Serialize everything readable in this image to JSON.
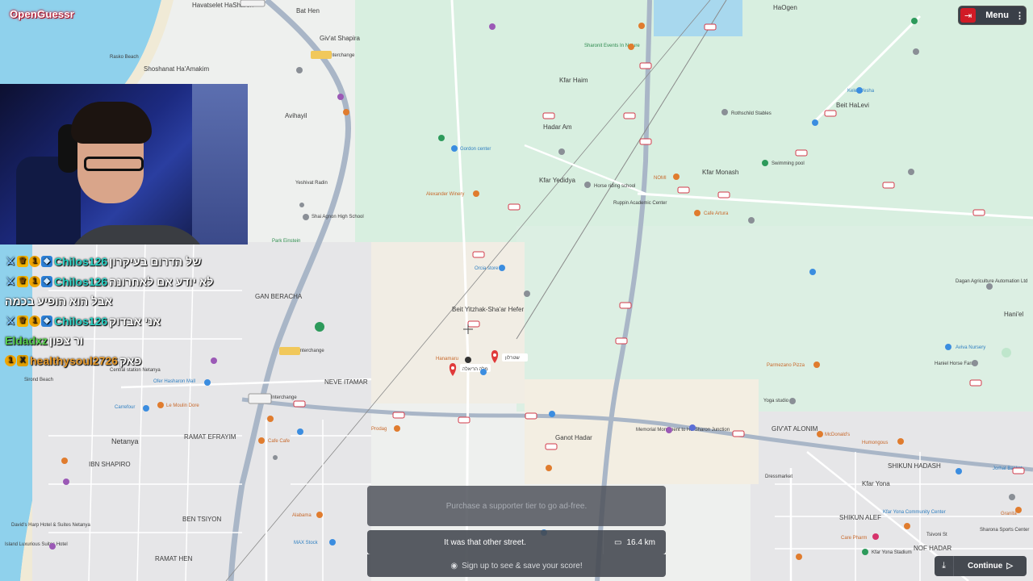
{
  "app": {
    "name": "OpenGuessr"
  },
  "colors": {
    "brand": "#d11b26",
    "panel": "#464a52",
    "user_cyan": "#2bd1c4",
    "user_green": "#58d14d",
    "user_orange": "#e89b2c"
  },
  "map": {
    "towns": [
      "Havatselet HaSharon",
      "Bat Hen",
      "Giv'at Shapira",
      "Shoshanat Ha'Amakim",
      "Avihayil",
      "Kfar Haim",
      "Hadar Am",
      "Kfar Yedidya",
      "Kfar Monash",
      "Beit HaLevi",
      "HaOgen",
      "Beit Yitzhak-Sha'ar Hefer",
      "GAN BERACHA",
      "NEVE ITAMAR",
      "Netanya",
      "RAMAT EFRAYIM",
      "IBN SHAPIRO",
      "BEN TSIYON",
      "RAMAT HEN",
      "Ganot Hadar",
      "GIV'AT ALONIM",
      "Kfar Yona",
      "SHIKUN HADASH",
      "SHIKUN ALEF",
      "NOF HADAR",
      "Hani'el"
    ],
    "pois": [
      "Rasko Beach",
      "Sharonit Events In Nature",
      "Kelev Yesha",
      "Rothschild Stables",
      "Gordon center",
      "Horse riding school",
      "Alexander Winery",
      "NOMI",
      "Ruppin Academic Center",
      "Cafe Artura",
      "Swimming pool",
      "Shai Agnon High School",
      "Yeshivat Radin",
      "Park Einstein",
      "Orcia store",
      "Dagan Agriculture Automation Ltd",
      "Aviva Nursery",
      "Haniel Horse Farm",
      "Parmezano Pizza",
      "Yoga studio",
      "Hanamaru",
      "שטרלון",
      "Ofer Hasharon Mall",
      "Central station Netanya",
      "Carrefour",
      "Le Moulin Dore",
      "Cafe Cafe",
      "Prodag",
      "Memorial Monument to Ha-Sharon Junction",
      "McDonald's",
      "Humongous",
      "Alabama",
      "MAX Stock",
      "Sirond Beach",
      "David's Harp Hotel & Suites Netanya",
      "Island Luxurious Suites Hotel",
      "Kfar Yona Community Center",
      "Kfar Yona Stadium",
      "Care Pharm",
      "Sharona Sports Center",
      "Granita",
      "Dressmarket",
      "Jorhat Basket",
      "Tsivoni St"
    ],
    "interchanges": [
      "Beit Lid Interchange",
      "Netanya Interchange",
      "Netanya Interchange"
    ]
  },
  "chat": {
    "messages": [
      {
        "user": "Chilos126",
        "text": "של הדרום בעיקרון",
        "badges": [
          "sword-icon",
          "crown-icon",
          "coin-icon",
          "cube-icon"
        ],
        "color": "cyan"
      },
      {
        "user": "Chilos126",
        "text": "לא יודע אם לאחרונה",
        "badges": [
          "sword-icon",
          "crown-icon",
          "coin-icon",
          "cube-icon"
        ],
        "color": "cyan"
      },
      {
        "user": "",
        "text": "אבל הוא הופיע בכמה",
        "badges": [],
        "color": "cyan"
      },
      {
        "user": "Chilos126",
        "text": "אני אבדוק",
        "badges": [
          "sword-icon",
          "crown-icon",
          "coin-icon",
          "cube-icon"
        ],
        "color": "cyan"
      },
      {
        "user": "Eldadxz",
        "text": "ור צפון",
        "badges": [],
        "color": "green"
      },
      {
        "user": "healthysoul2726",
        "text": "פאק",
        "badges": [
          "coin-icon",
          "x-icon"
        ],
        "color": "orange"
      }
    ]
  },
  "topbar": {
    "exit_icon": "exit-icon",
    "menu_label": "Menu",
    "menu_icon": "kebab-icon"
  },
  "result": {
    "ad_text": "Purchase a supporter tier to go ad-free.",
    "message": "It was that other street.",
    "distance": "16.4 km",
    "distance_icon": "ruler-icon",
    "signup_text": "Sign up to see & save your score!",
    "signup_icon": "user-icon"
  },
  "controls": {
    "download_icon": "download-icon",
    "continue_label": "Continue",
    "continue_icon": "play-icon"
  },
  "guess_pin": {
    "label": "מלה הריאלה"
  }
}
